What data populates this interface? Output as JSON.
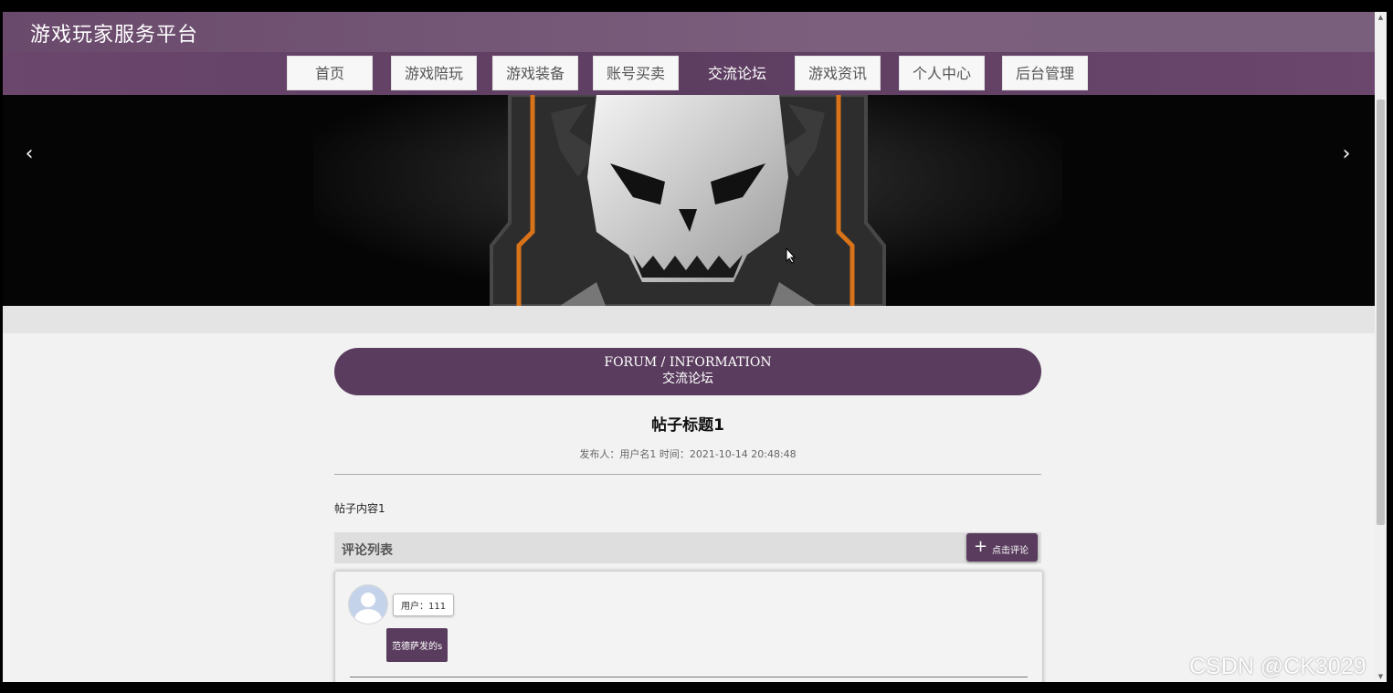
{
  "site": {
    "title": "游戏玩家服务平台"
  },
  "nav": {
    "items": [
      {
        "label": "首页",
        "active": false
      },
      {
        "label": "游戏陪玩",
        "active": false
      },
      {
        "label": "游戏装备",
        "active": false
      },
      {
        "label": "账号买卖",
        "active": false
      },
      {
        "label": "交流论坛",
        "active": true
      },
      {
        "label": "游戏资讯",
        "active": false
      },
      {
        "label": "个人中心",
        "active": false
      },
      {
        "label": "后台管理",
        "active": false
      }
    ]
  },
  "banner": {
    "prev_icon": "chevron-left-icon",
    "next_icon": "chevron-right-icon",
    "prev_glyph": "‹",
    "next_glyph": "›"
  },
  "forum_header": {
    "en": "FORUM / INFORMATION",
    "cn": "交流论坛"
  },
  "post": {
    "title": "帖子标题1",
    "meta": "发布人：用户名1 时间：2021-10-14 20:48:48",
    "content": "帖子内容1"
  },
  "comments": {
    "title": "评论列表",
    "add_button_label": "点击评论",
    "add_button_icon": "+",
    "items": [
      {
        "user": "用户：111",
        "text": "范德萨发的s"
      }
    ]
  },
  "watermark": "CSDN @CK3029",
  "colors": {
    "primary": "#5a3d5e",
    "topbar": "#7a5f7c",
    "page_bg": "#f2f2f2"
  }
}
